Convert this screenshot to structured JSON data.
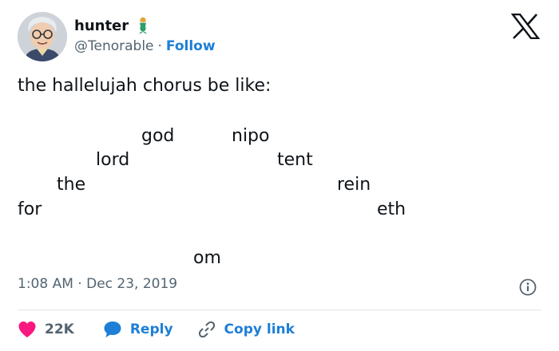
{
  "author": {
    "name": "hunter",
    "handle": "@Tenorable",
    "separator": "·",
    "follow_label": "Follow",
    "name_emoji_icon": "mermaid-icon",
    "avatar_icon": "avatar-cartoon-face"
  },
  "platform_icon": "x-logo-icon",
  "tweet": {
    "text": "the hallelujah chorus be like:",
    "words": [
      "for",
      "the",
      "lord",
      "god",
      "nipo",
      "tent",
      "om",
      "rein",
      "eth"
    ]
  },
  "timestamp": {
    "time": "1:08 AM",
    "separator": "·",
    "date": "Dec 23, 2019"
  },
  "actions": {
    "likes": "22K",
    "reply_label": "Reply",
    "copy_link_label": "Copy link"
  },
  "colors": {
    "accent": "#1d7fd6",
    "like": "#f91880",
    "text": "#0f1419",
    "muted": "#536471",
    "divider": "#e1e6ea"
  }
}
